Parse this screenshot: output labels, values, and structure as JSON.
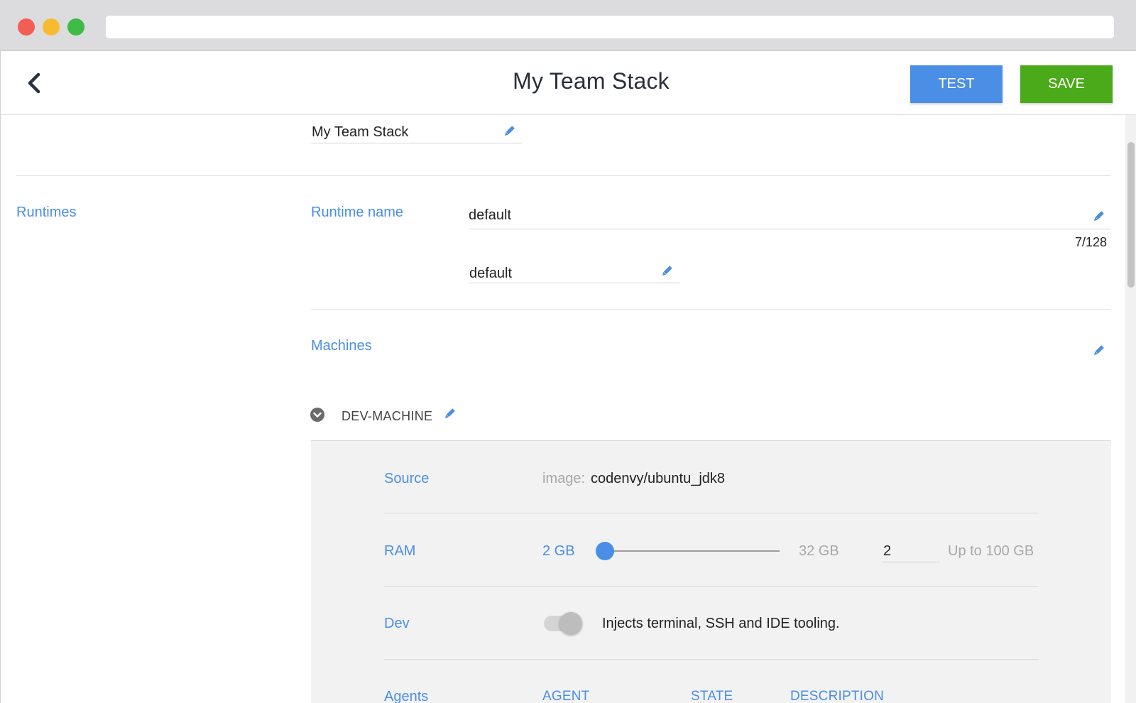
{
  "header": {
    "title": "My Team Stack",
    "test_label": "TEST",
    "save_label": "SAVE"
  },
  "stack": {
    "name": "My Team Stack"
  },
  "runtimes": {
    "section_label": "Runtimes",
    "runtime_name_label": "Runtime name",
    "runtime_name_value": "default",
    "runtime_name_counter": "7/128",
    "environment_value": "default"
  },
  "machines": {
    "section_label": "Machines",
    "machine_name": "DEV-MACHINE",
    "source": {
      "label": "Source",
      "prefix": "image:",
      "value": "codenvy/ubuntu_jdk8"
    },
    "ram": {
      "label": "RAM",
      "min_label": "2 GB",
      "max_label": "32 GB",
      "input_value": "2",
      "limit_label": "Up to 100 GB",
      "slider_fraction": 0.0
    },
    "dev": {
      "label": "Dev",
      "description": "Injects terminal, SSH and IDE tooling.",
      "enabled": false
    },
    "agents": {
      "label": "Agents",
      "columns": [
        "AGENT",
        "STATE",
        "DESCRIPTION"
      ]
    }
  },
  "colors": {
    "accent": "#4b8ee6",
    "save": "#4aaa1a"
  },
  "icons": {
    "back": "chevron-left-icon",
    "edit": "pencil-icon",
    "expand": "chevron-down-circle-icon"
  }
}
